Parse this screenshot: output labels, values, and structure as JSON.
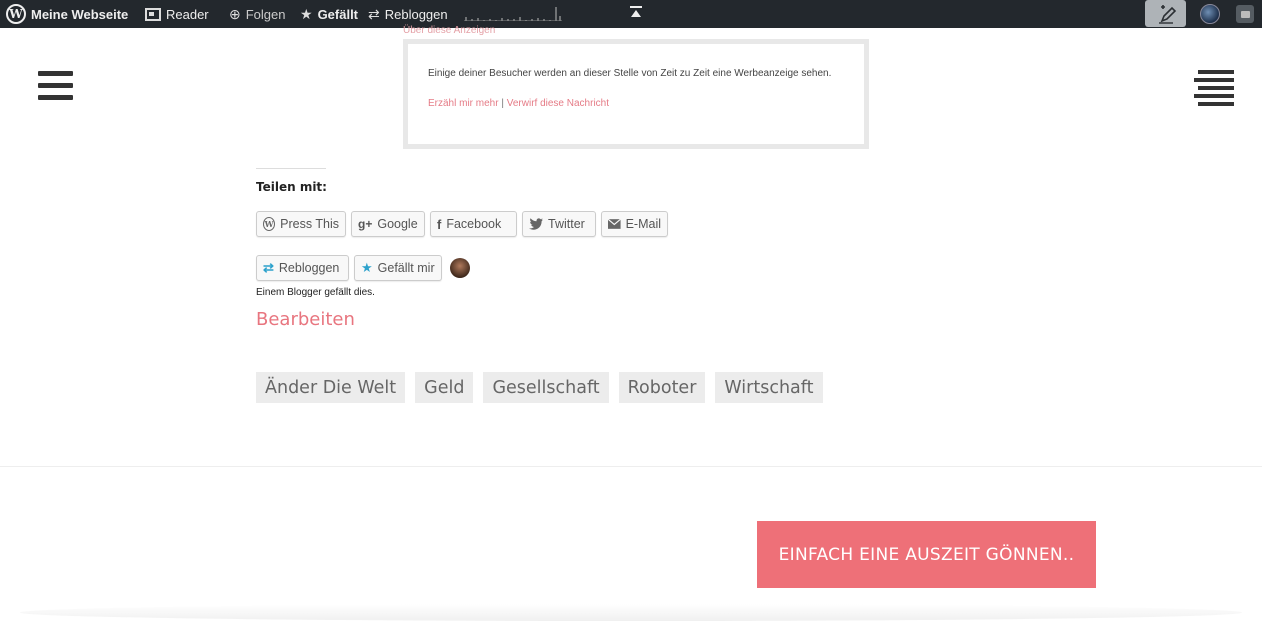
{
  "adminbar": {
    "site_label": "Meine Webseite",
    "reader_label": "Reader",
    "follow_label": "Folgen",
    "like_label": "Gefällt",
    "reblog_label": "Rebloggen"
  },
  "ad": {
    "caption": "Über diese Anzeigen",
    "text": "Einige deiner Besucher werden an dieser Stelle von Zeit zu Zeit eine Werbeanzeige sehen.",
    "learn_more": "Erzähl mir mehr",
    "separator": "|",
    "dismiss": "Verwirf diese Nachricht"
  },
  "share": {
    "title": "Teilen mit:",
    "buttons": [
      {
        "label": "Press This",
        "icon": "wordpress-icon"
      },
      {
        "label": "Google",
        "icon": "google-plus-icon"
      },
      {
        "label": "Facebook",
        "icon": "facebook-icon"
      },
      {
        "label": "Twitter",
        "icon": "twitter-icon"
      },
      {
        "label": "E-Mail",
        "icon": "mail-icon"
      }
    ]
  },
  "likes": {
    "reblog_label": "Rebloggen",
    "like_label": "Gefällt mir",
    "count_text": "Einem Blogger gefällt dies."
  },
  "post": {
    "edit_label": "Bearbeiten",
    "tags": [
      "Änder Die Welt",
      "Geld",
      "Gesellschaft",
      "Roboter",
      "Wirtschaft"
    ]
  },
  "cta": {
    "label": "EINFACH EINE AUSZEIT GÖNNEN.."
  },
  "colors": {
    "accent": "#ee7078",
    "link": "#e57b86",
    "adminbar": "#23282d"
  }
}
